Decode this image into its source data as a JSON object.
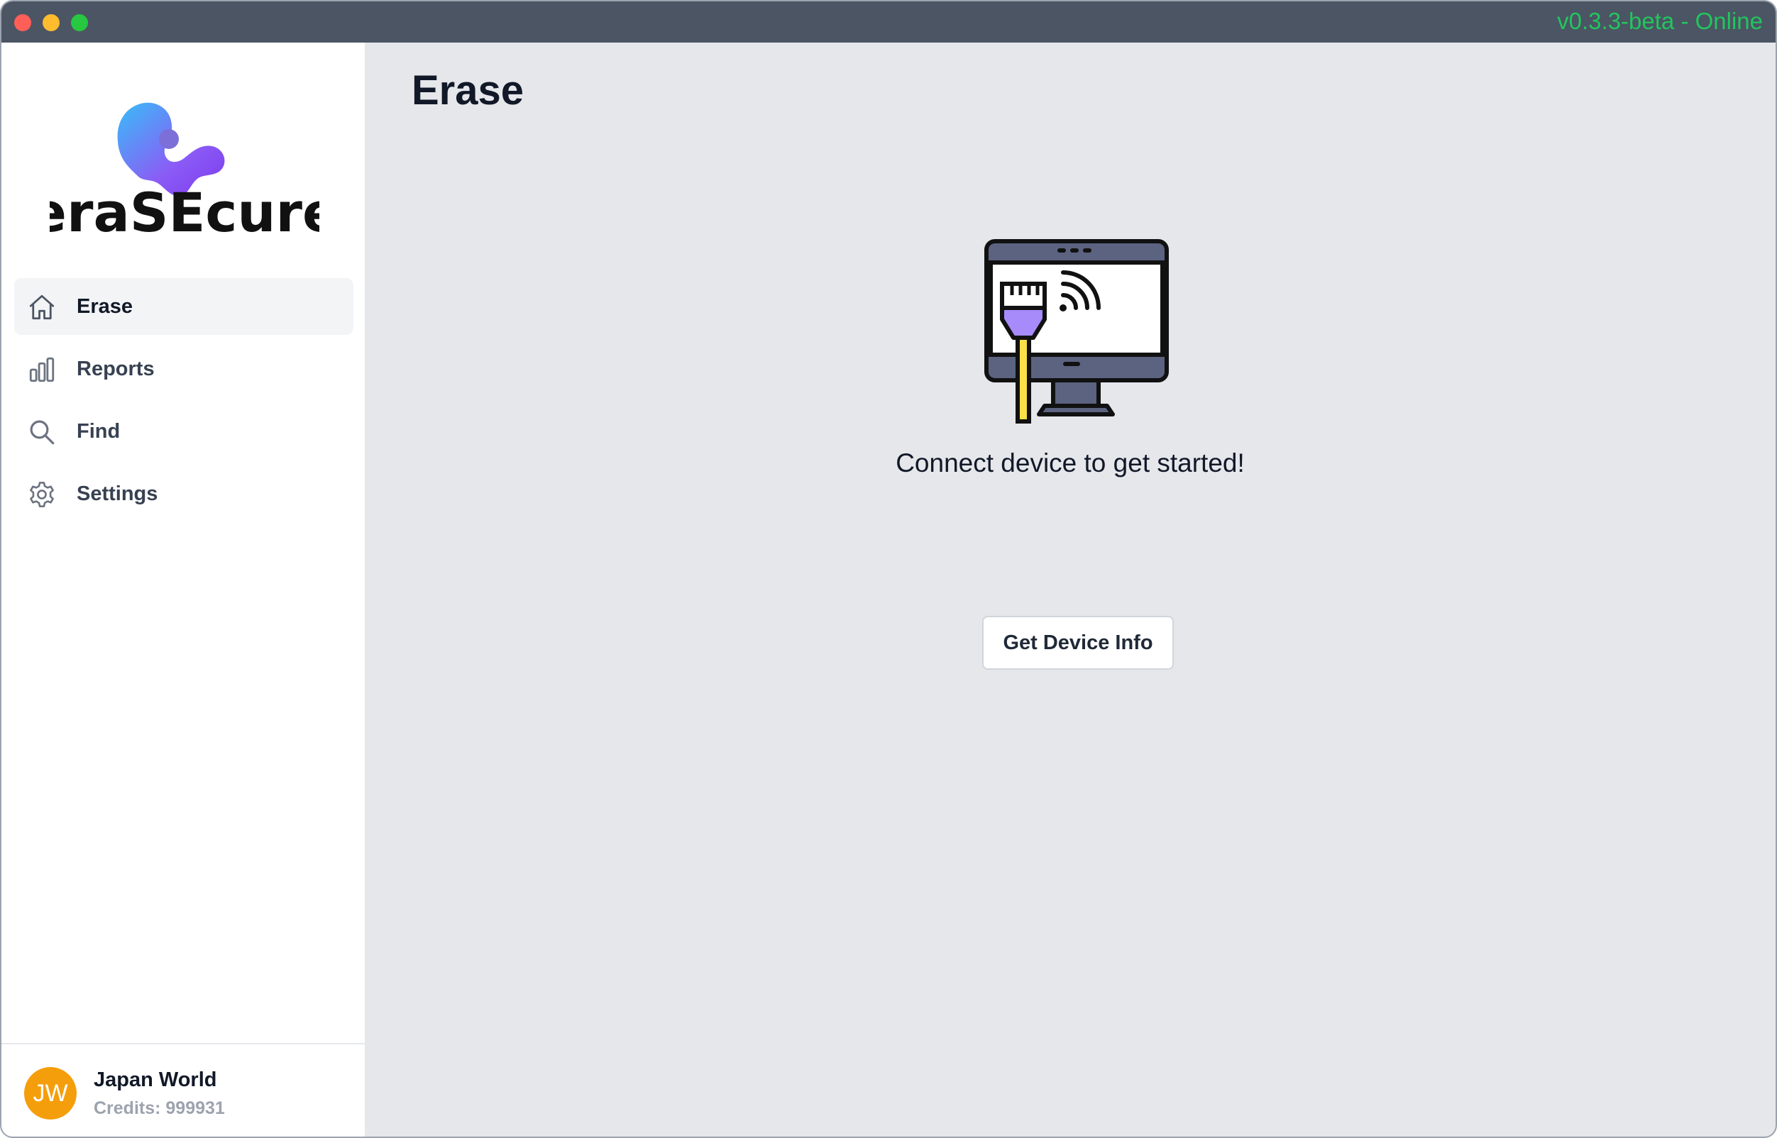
{
  "window": {
    "version_status": "v0.3.3-beta - Online",
    "status_color": "#22c55e"
  },
  "sidebar": {
    "logo_text": "eraSEcure",
    "items": [
      {
        "label": "Erase",
        "icon": "home-icon",
        "active": true
      },
      {
        "label": "Reports",
        "icon": "bar-chart-icon",
        "active": false
      },
      {
        "label": "Find",
        "icon": "search-icon",
        "active": false
      },
      {
        "label": "Settings",
        "icon": "gear-icon",
        "active": false
      }
    ],
    "user": {
      "initials": "JW",
      "name": "Japan World",
      "credits": "Credits: 999931",
      "avatar_color": "#f59e0b"
    }
  },
  "main": {
    "title": "Erase",
    "message": "Connect device to get started!",
    "button_label": "Get Device Info",
    "illustration": "monitor-ethernet-icon"
  }
}
